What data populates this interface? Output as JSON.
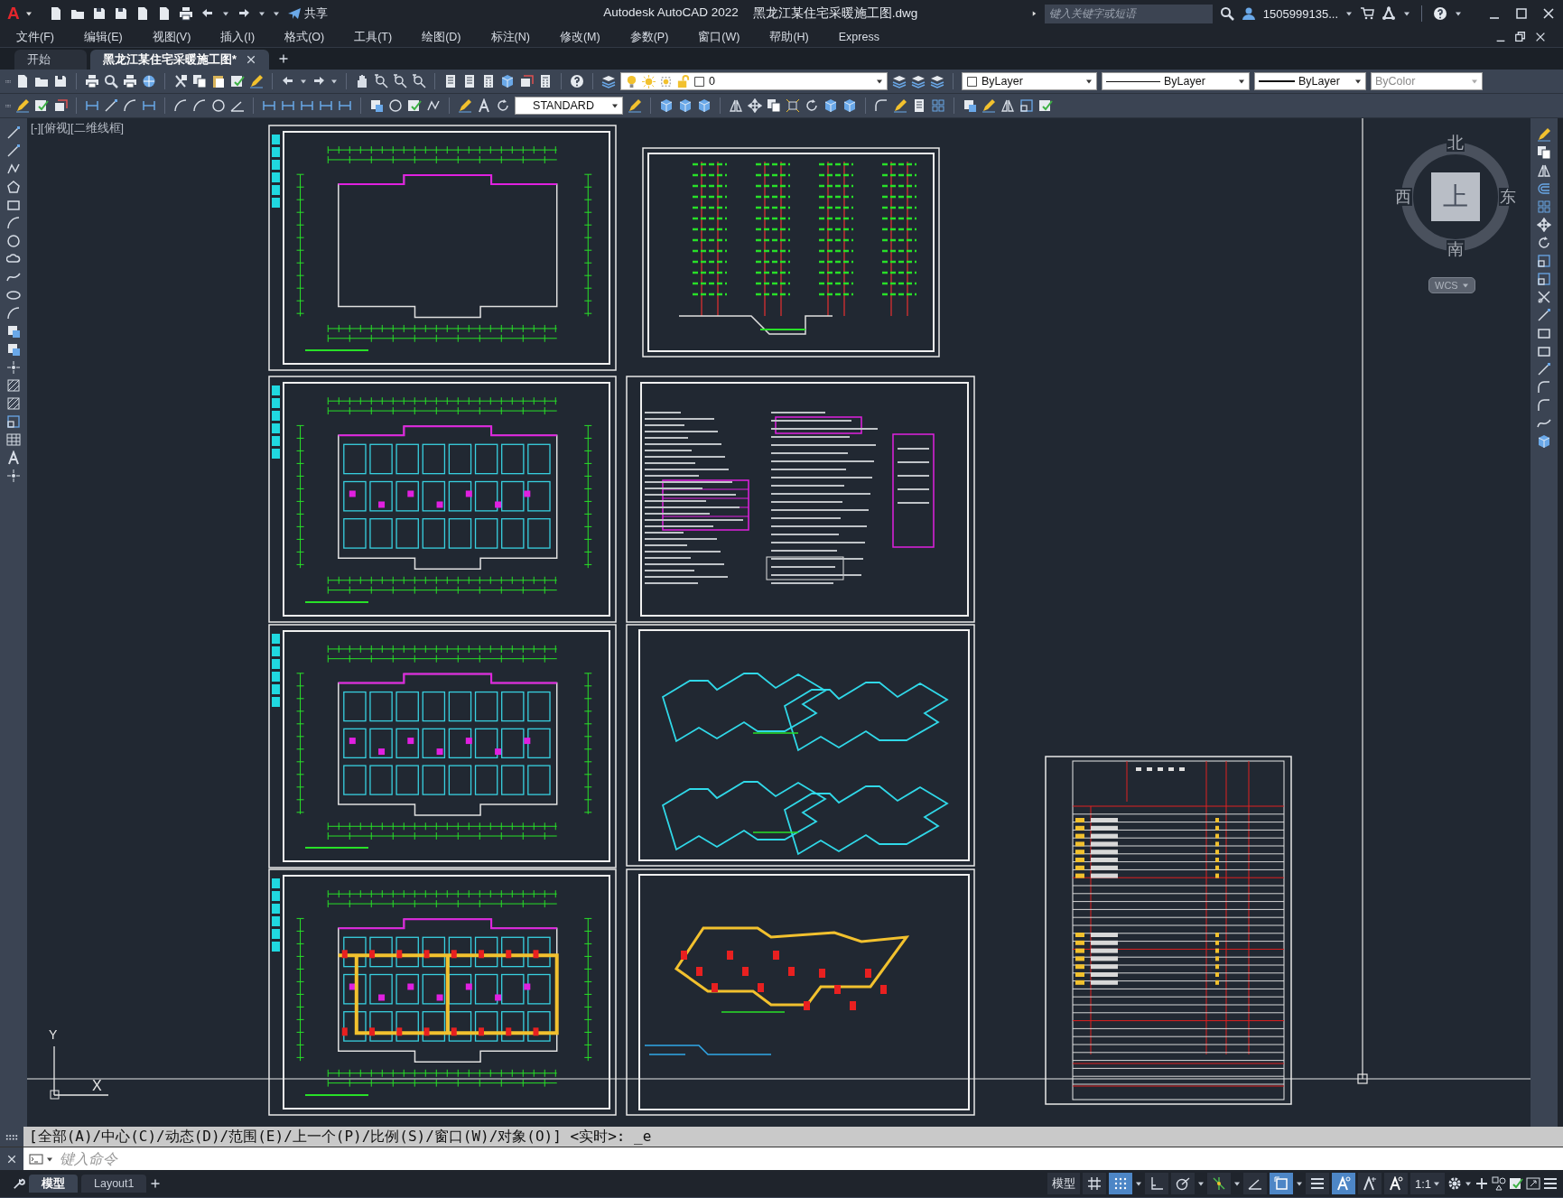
{
  "title_bar": {
    "logo": "A",
    "share": "共享",
    "title": "Autodesk AutoCAD 2022",
    "file_name": "黑龙江某住宅采暖施工图.dwg",
    "search": {
      "placeholder": "键入关键字或短语"
    },
    "user": "1505999135..."
  },
  "menu": [
    "文件(F)",
    "编辑(E)",
    "视图(V)",
    "插入(I)",
    "格式(O)",
    "工具(T)",
    "绘图(D)",
    "标注(N)",
    "修改(M)",
    "参数(P)",
    "窗口(W)",
    "帮助(H)",
    "Express"
  ],
  "doc_tabs": [
    {
      "label": "开始",
      "selected": false
    },
    {
      "label": "黑龙江某住宅采暖施工图*",
      "selected": true
    }
  ],
  "properties_toolbar": {
    "layer": "0",
    "color_setting": "ByLayer",
    "linetype": "ByLayer",
    "lineweight": "ByLayer",
    "plot_style": {
      "value": "ByColor",
      "disabled": true
    }
  },
  "styles_toolbar": {
    "text_style": "STANDARD"
  },
  "viewport": {
    "label": "[-][俯视][二维线框]",
    "viewcube": {
      "north": "北",
      "south": "南",
      "east": "东",
      "west": "西",
      "face": "上",
      "ucs_menu": "WCS"
    },
    "ucs": {
      "y": "Y",
      "x": "X"
    }
  },
  "command_line": {
    "history": "[全部(A)/中心(C)/动态(D)/范围(E)/上一个(P)/比例(S)/窗口(W)/对象(O)] <实时>: _e",
    "placeholder": "键入命令"
  },
  "layout_tabs": [
    {
      "label": "模型",
      "selected": true
    },
    {
      "label": "Layout1",
      "selected": false
    }
  ],
  "status_bar": {
    "space": "模型",
    "scale": "1:1",
    "toggles": [
      {
        "on": false
      },
      {
        "on": true
      },
      {
        "on": false
      },
      {
        "on": false
      },
      {
        "on": false
      },
      {
        "on": false
      },
      {
        "on": true
      },
      {
        "on": false
      },
      {
        "on": true
      },
      {
        "on": false
      },
      {
        "on": false
      }
    ]
  }
}
